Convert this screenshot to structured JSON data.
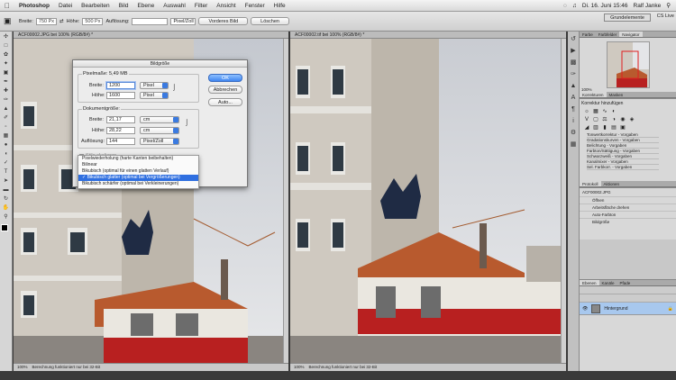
{
  "menubar": {
    "apple": "",
    "app": "Photoshop",
    "items": [
      "Datei",
      "Bearbeiten",
      "Bild",
      "Ebene",
      "Auswahl",
      "Filter",
      "Ansicht",
      "Fenster",
      "Hilfe"
    ],
    "datetime": "Di. 16. Juni 15:46",
    "user": "Ralf Janke"
  },
  "optbar": {
    "breite_label": "Breite:",
    "breite_value": "750 Px",
    "hoehe_label": "Höhe:",
    "hoehe_value": "500 Px",
    "aufloesung_label": "Auflösung:",
    "unit": "Pixel/Zoll",
    "front_image": "Vorderes Bild",
    "clear": "Löschen",
    "workspace": "Grundelemente",
    "cslive": "CS Live"
  },
  "doc_left": {
    "tab": "ACF00002.JPG bei 100% (RGB/8#) *",
    "zoom": "100%",
    "status": "Berechnung funktioniert nur bei 32-Bit"
  },
  "doc_right": {
    "tab": "ACF00002.tif bei 100% (RGB/8#) *",
    "zoom": "100%",
    "status": "Berechnung funktioniert nur bei 32-Bit"
  },
  "dialog": {
    "title": "Bildgröße",
    "pixel_group": "Pixelmaße: 5,49 MB",
    "breite_label": "Breite:",
    "breite_value": "1200",
    "breite_unit": "Pixel",
    "hoehe_label": "Höhe:",
    "hoehe_value": "1600",
    "hoehe_unit": "Pixel",
    "doc_group": "Dokumentgröße:",
    "doc_breite_label": "Breite:",
    "doc_breite_value": "21,17",
    "doc_breite_unit": "cm",
    "doc_hoehe_label": "Höhe:",
    "doc_hoehe_value": "28,22",
    "doc_hoehe_unit": "cm",
    "aufl_label": "Auflösung:",
    "aufl_value": "144",
    "aufl_unit": "Pixel/Zoll",
    "ok": "OK",
    "cancel": "Abbrechen",
    "auto": "Auto...",
    "stile": "Stile skalieren",
    "options": [
      "Pixelwiederholung (harte Kanten beibehalten)",
      "Bilinear",
      "Bikubisch (optimal für einen glatten Verlauf)",
      "Bikubisch glatter (optimal bei Vergrößerungen)",
      "Bikubisch schärfer (optimal bei Verkleinerungen)"
    ],
    "selected_index": 3
  },
  "panels": {
    "nav_tabs": [
      "Farbe",
      "Farbfelder",
      "Navigator"
    ],
    "nav_zoom": "100%",
    "adj_tabs": [
      "Korrekturen",
      "Masken"
    ],
    "adj_header": "Korrektur hinzufügen",
    "presets": [
      "Tonwertkorrektur - Vorgaben",
      "Gradationskurven - Vorgaben",
      "Belichtung - Vorgaben",
      "Farbton/Sättigung - Vorgaben",
      "Schwarzweiß - Vorgaben",
      "Kanalmixer - Vorgaben",
      "Sel. Farbkorr. - Vorgaben"
    ],
    "hist_tabs": [
      "Protokoll",
      "Aktionen"
    ],
    "hist_file": "ACF00002.JPG",
    "hist_steps": [
      "Öffnen",
      "Arbeitsfläche drehen",
      "Auto-Farbton",
      "Bildgröße"
    ],
    "layer_tabs": [
      "Ebenen",
      "Kanäle",
      "Pfade"
    ],
    "layer_name": "Hintergrund"
  }
}
